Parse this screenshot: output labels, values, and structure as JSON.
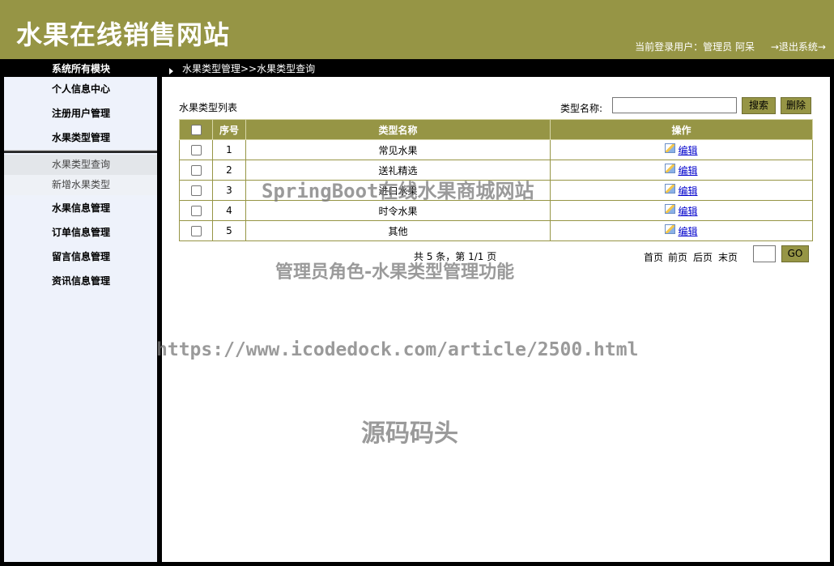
{
  "header": {
    "title": "水果在线销售网站",
    "user_info": "当前登录用户：管理员 阿呆",
    "logout": "→退出系统→"
  },
  "topbar": {
    "module_title": "系统所有模块",
    "breadcrumb": "水果类型管理>>水果类型查询"
  },
  "sidebar": {
    "items": [
      {
        "label": "个人信息中心"
      },
      {
        "label": "注册用户管理"
      },
      {
        "label": "水果类型管理"
      },
      {
        "label": "水果信息管理"
      },
      {
        "label": "订单信息管理"
      },
      {
        "label": "留言信息管理"
      },
      {
        "label": "资讯信息管理"
      }
    ],
    "sub_items": [
      {
        "label": "水果类型查询"
      },
      {
        "label": "新增水果类型"
      }
    ]
  },
  "main": {
    "list_title": "水果类型列表",
    "search_label": "类型名称:",
    "search_value": "",
    "search_button": "搜索",
    "delete_button": "删除",
    "columns": [
      "序号",
      "类型名称",
      "操作"
    ],
    "rows": [
      {
        "no": "1",
        "name": "常见水果",
        "action": "编辑"
      },
      {
        "no": "2",
        "name": "送礼精选",
        "action": "编辑"
      },
      {
        "no": "3",
        "name": "进口水果",
        "action": "编辑"
      },
      {
        "no": "4",
        "name": "时令水果",
        "action": "编辑"
      },
      {
        "no": "5",
        "name": "其他",
        "action": "编辑"
      }
    ],
    "page_info": "共 5 条，第 1/1 页",
    "pager": {
      "first": "首页",
      "prev": "前页",
      "next": "后页",
      "last": "末页"
    },
    "go_button": "GO"
  },
  "watermarks": {
    "line1": "SpringBoot在线水果商城网站",
    "line2": "管理员角色-水果类型管理功能",
    "line3": "https://www.icodedock.com/article/2500.html",
    "line4": "源码码头"
  }
}
